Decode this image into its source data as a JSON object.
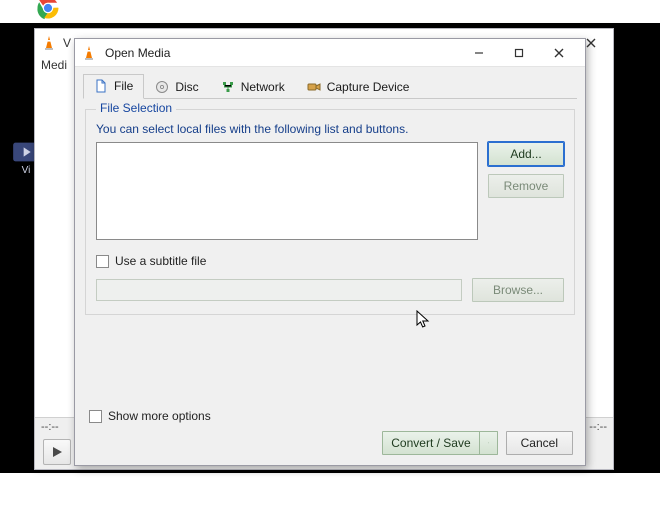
{
  "desktop": {
    "vid_label": "Vi"
  },
  "vlc_main": {
    "title": "V",
    "menubar": "Medi",
    "time_left": "--:--",
    "time_right": "--:--"
  },
  "dialog": {
    "title": "Open Media",
    "tabs": {
      "file": "File",
      "disc": "Disc",
      "network": "Network",
      "capture": "Capture Device"
    },
    "file_selection": {
      "legend": "File Selection",
      "hint": "You can select local files with the following list and buttons.",
      "add": "Add...",
      "remove": "Remove"
    },
    "subs": {
      "checkbox": "Use a subtitle file",
      "browse": "Browse..."
    },
    "show_more": "Show more options",
    "convert_save": "Convert / Save",
    "cancel": "Cancel"
  }
}
